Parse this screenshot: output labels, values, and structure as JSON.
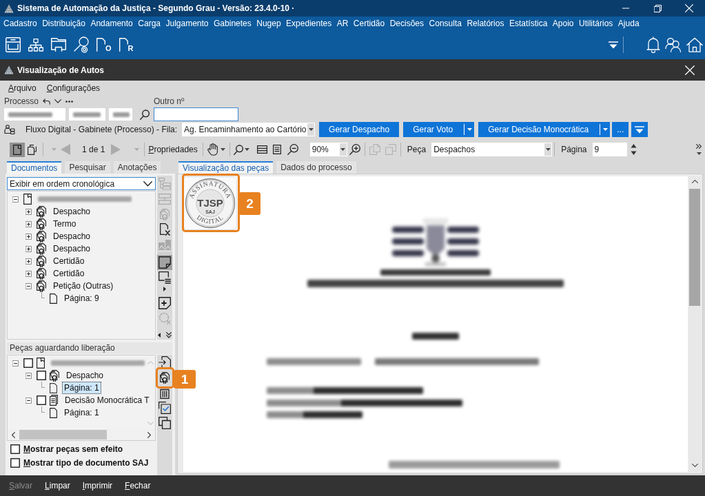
{
  "window": {
    "title": "Sistema de Automação da Justiça - Segundo Grau - Versão: 23.4.0-10 ·"
  },
  "menu": [
    "Cadastro",
    "Distribuição",
    "Andamento",
    "Carga",
    "Julgamento",
    "Gabinetes",
    "Nugep",
    "Expedientes",
    "AR",
    "Certidão",
    "Decisões",
    "Consulta",
    "Relatórios",
    "Estatística",
    "Apoio",
    "Utilitários",
    "Ajuda"
  ],
  "toolbar": {
    "letter_buttons": [
      "O",
      "R"
    ]
  },
  "autos": {
    "title": "Visualização de Autos",
    "menu": [
      "Arquivo",
      "Configurações"
    ]
  },
  "process": {
    "label": "Processo",
    "other_number_label": "Outro nº"
  },
  "flow": {
    "label": "Fluxo Digital - Gabinete (Processo) - Fila:",
    "queue": "Ag. Encaminhamento ao Cartório"
  },
  "actions": [
    {
      "label": "Gerar Despacho",
      "split": false
    },
    {
      "label": "Gerar Voto",
      "split": true
    },
    {
      "label": "Gerar Decisão Monocrática",
      "split": true
    },
    {
      "label": "...",
      "split": false
    }
  ],
  "viewer_toolbar": {
    "view_modes": [
      {
        "selected": true
      },
      {
        "selected": false
      }
    ],
    "pager": {
      "text": "1 de 1",
      "disabled": true
    },
    "properties": "Propriedades",
    "zoom": "90%",
    "page_tools_disabled": true,
    "piece_label": "Peça",
    "piece": "Despachos",
    "page_label": "Página",
    "page": "9"
  },
  "left_tabs": [
    {
      "label": "Documentos",
      "selected": true
    },
    {
      "label": "Pesquisar",
      "selected": false
    },
    {
      "label": "Anotações",
      "selected": false
    }
  ],
  "order": "Exibir em ordem cronológica",
  "documents": {
    "kind": "record",
    "selected": false,
    "expanded": true,
    "children": [
      {
        "kind": "signed",
        "label": "Despacho",
        "selected": false,
        "expanded": false
      },
      {
        "kind": "signed",
        "label": "Termo",
        "selected": false,
        "expanded": false
      },
      {
        "kind": "signed",
        "label": "Despacho",
        "selected": false,
        "expanded": false
      },
      {
        "kind": "signed",
        "label": "Despacho",
        "selected": false,
        "expanded": false
      },
      {
        "kind": "signed",
        "label": "Certidão",
        "selected": false,
        "expanded": false
      },
      {
        "kind": "signed",
        "label": "Certidão",
        "selected": false,
        "expanded": false
      },
      {
        "kind": "signed",
        "label": "Petição (Outras)",
        "selected": false,
        "expanded": true,
        "children": [
          {
            "kind": "page",
            "label": "Página: 9",
            "selected": false
          }
        ]
      }
    ]
  },
  "doc_tools": [
    {
      "disabled": true,
      "pressed": false
    },
    {
      "disabled": true,
      "pressed": false
    },
    {
      "disabled": true,
      "pressed": false
    },
    {
      "disabled": false,
      "pressed": false
    },
    {
      "disabled": true,
      "pressed": false
    },
    {
      "disabled": false,
      "pressed": true
    },
    {
      "disabled": false,
      "pressed": false
    },
    {
      "disabled": false,
      "pressed": false
    },
    {
      "disabled": true,
      "pressed": false
    }
  ],
  "pending": {
    "title": "Peças aguardando liberação",
    "tree": {
      "kind": "record",
      "checked": false,
      "selected": false,
      "expanded": true,
      "children": [
        {
          "kind": "signed",
          "label": "Despacho",
          "checked": false,
          "selected": false,
          "expanded": true,
          "children": [
            {
              "kind": "page",
              "label": "Página: 1",
              "selected": true
            }
          ]
        },
        {
          "kind": "draft",
          "label": "Decisão Monocrática T",
          "checked": false,
          "selected": false,
          "expanded": true,
          "children": [
            {
              "kind": "page",
              "label": "Página: 1",
              "selected": false
            }
          ]
        }
      ]
    }
  },
  "pending_tools": [
    {
      "disabled": false
    },
    {
      "disabled": false
    },
    {
      "disabled": false
    },
    {
      "disabled": false
    },
    {
      "disabled": false
    }
  ],
  "options": [
    {
      "label": "Mostrar peças sem efeito",
      "checked": false
    },
    {
      "label": "Mostrar tipo de documento SAJ",
      "checked": false
    }
  ],
  "right_tabs": [
    {
      "label": "Visualização das peças",
      "selected": true
    },
    {
      "label": "Dados do processo",
      "selected": false
    }
  ],
  "seal": {
    "top": "ASSINATURA",
    "center": "TJSP",
    "sub": "SAJ",
    "bottom": "DIGITAL"
  },
  "bottom_bar": [
    {
      "label": "Salvar",
      "disabled": true
    },
    {
      "label": "Limpar",
      "disabled": false
    },
    {
      "label": "Imprimir",
      "disabled": false
    },
    {
      "label": "Fechar",
      "disabled": false
    }
  ],
  "callouts": [
    {
      "label": "1"
    },
    {
      "label": "2"
    }
  ]
}
